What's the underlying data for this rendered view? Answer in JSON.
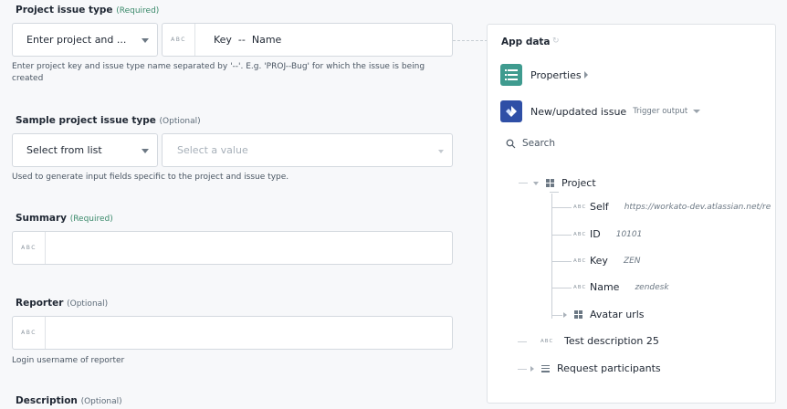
{
  "form": {
    "project_issue_type": {
      "label": "Project issue type",
      "tag": "(Required)",
      "selector_value": "Enter project and ...",
      "abc": "ABC",
      "value": "Key  --  Name",
      "help": "Enter project key and issue type name separated by '--'. E.g. 'PROJ--Bug' for which the issue is being created"
    },
    "sample_project_issue_type": {
      "label": "Sample project issue type",
      "tag": "(Optional)",
      "selector_value": "Select from list",
      "placeholder": "Select a value",
      "help": "Used to generate input fields specific to the project and issue type."
    },
    "summary": {
      "label": "Summary",
      "tag": "(Required)",
      "abc": "ABC"
    },
    "reporter": {
      "label": "Reporter",
      "tag": "(Optional)",
      "abc": "ABC",
      "help": "Login username of reporter"
    },
    "description": {
      "label": "Description",
      "tag": "(Optional)"
    }
  },
  "app_data": {
    "title": "App data",
    "refresh_icon": "refresh-icon",
    "properties_label": "Properties",
    "trigger_label": "New/updated issue",
    "trigger_output": "Trigger output",
    "search_label": "Search",
    "colors": {
      "properties_icon_bg": "#3f9b8f",
      "jira_icon_bg": "#2f4fa6"
    },
    "tree": {
      "project": "Project",
      "self_label": "Self",
      "self_value": "https://workato-dev.atlassian.net/re",
      "id_label": "ID",
      "id_value": "10101",
      "key_label": "Key",
      "key_value": "ZEN",
      "name_label": "Name",
      "name_value": "zendesk",
      "avatar_urls": "Avatar urls",
      "test_description": "Test description 25",
      "request_participants": "Request participants",
      "abc": "ABC"
    }
  }
}
